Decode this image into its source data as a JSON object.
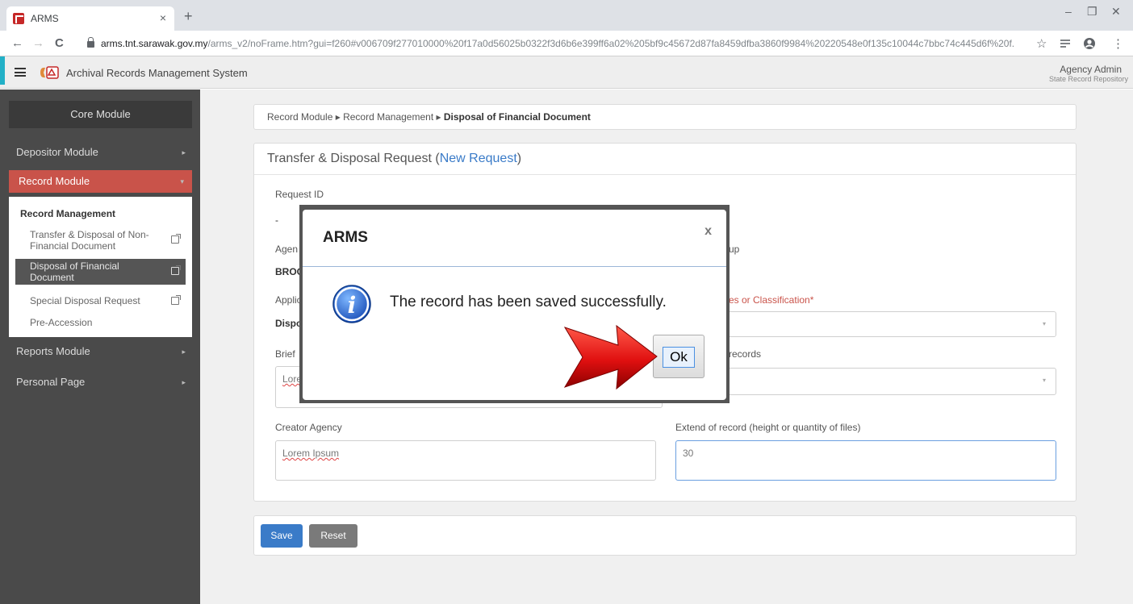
{
  "browser": {
    "tab_title": "ARMS",
    "tab_close": "×",
    "new_tab": "+",
    "url_domain": "arms.tnt.sarawak.gov.my",
    "url_path": "/arms_v2/noFrame.htm?gui=f260#v006709f277010000%20f17a0d56025b0322f3d6b6e399ff6a02%205bf9c45672d87fa8459dfba3860f9984%20220548e0f135c10044c7bbc74c445d6f%20f...",
    "minimize": "–",
    "restore": "❐",
    "close": "✕",
    "back": "←",
    "forward": "→",
    "reload": "C",
    "star": "☆",
    "menu": "⋮"
  },
  "header": {
    "app_title": "Archival Records Management System",
    "user_name": "Agency Admin",
    "user_role": "State Record Repository"
  },
  "sidebar": {
    "core_module": "Core Module",
    "items": [
      {
        "label": "Depositor Module",
        "chevron": "▸"
      },
      {
        "label": "Record Module",
        "chevron": "▾"
      },
      {
        "label": "Reports Module",
        "chevron": "▸"
      },
      {
        "label": "Personal Page",
        "chevron": "▸"
      }
    ],
    "submenu_heading": "Record Management",
    "submenu": [
      {
        "label": "Transfer & Disposal of Non-Financial Document"
      },
      {
        "label": "Disposal of Financial Document"
      },
      {
        "label": "Special Disposal Request"
      },
      {
        "label": "Pre-Accession"
      }
    ]
  },
  "breadcrumb": {
    "part1": "Record Module",
    "sep": "▸",
    "part2": "Record Management",
    "current": "Disposal of Financial Document"
  },
  "form": {
    "title_prefix": "Transfer & Disposal Request (",
    "title_link": "New Request",
    "title_suffix": ")",
    "request_id_label": "Request ID",
    "request_id_value": "-",
    "agency_label": "Agen",
    "agency_value": "BROO",
    "group_label_tail": "up",
    "applic_label": "Applic",
    "applic_value": "Dispo",
    "series_label_tail": "es or Classification*",
    "brief_label": "Brief",
    "records_label_tail": "records",
    "brief_value_frag": "Lore",
    "creator_agency_label": "Creator Agency",
    "creator_agency_value": "Lorem Ipsum",
    "extent_label": "Extend of record (height or quantity of files)",
    "extent_value": "30",
    "caret": "▾"
  },
  "buttons": {
    "save": "Save",
    "reset": "Reset"
  },
  "dialog": {
    "title": "ARMS",
    "close": "x",
    "message": "The record has been saved successfully.",
    "ok": "Ok",
    "info_glyph": "i"
  },
  "colors": {
    "accent_red": "#c9534a",
    "save_blue": "#3a7bc8",
    "reset_gray": "#7a7a7a",
    "sidebar_bg": "#4a4a4a"
  }
}
